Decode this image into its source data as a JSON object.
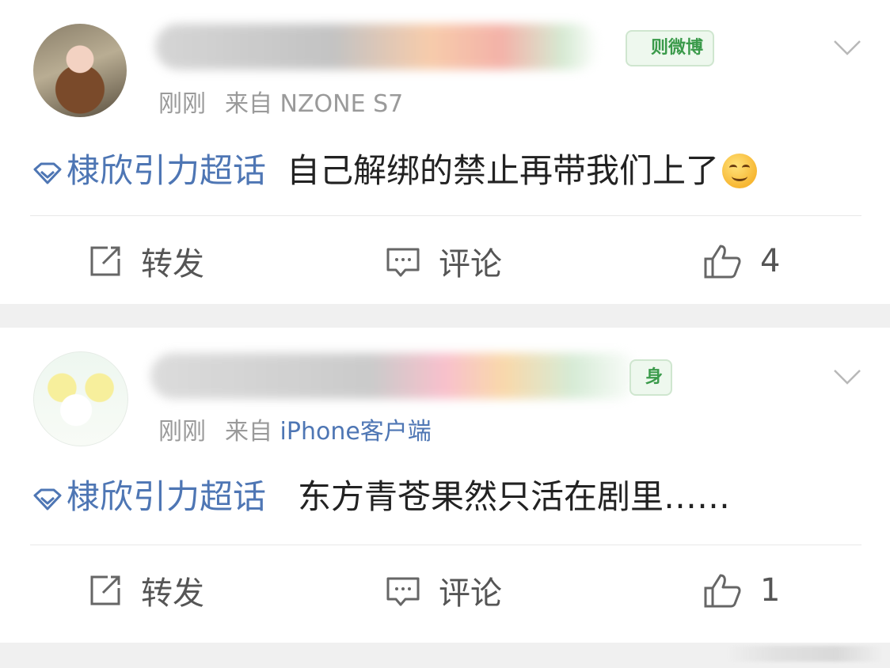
{
  "posts": [
    {
      "badge": "则微博",
      "time": "刚刚",
      "from_label": "来自",
      "source": "NZONE S7",
      "topic": "棣欣引力超话",
      "text": "自己解绑的禁止再带我们上了",
      "emoji": "smiling-face",
      "actions": {
        "repost": "转发",
        "comment": "评论",
        "like_count": "4"
      }
    },
    {
      "badge": "身",
      "time": "刚刚",
      "from_label": "来自",
      "source": "iPhone客户端",
      "topic": "棣欣引力超话",
      "text": "东方青苍果然只活在剧里……",
      "actions": {
        "repost": "转发",
        "comment": "评论",
        "like_count": "1"
      }
    }
  ],
  "colors": {
    "topic_blue": "#4e76b4",
    "meta_gray": "#9a9a9a",
    "badge_green": "#3a9a4a",
    "separator": "#f0f0f0"
  }
}
